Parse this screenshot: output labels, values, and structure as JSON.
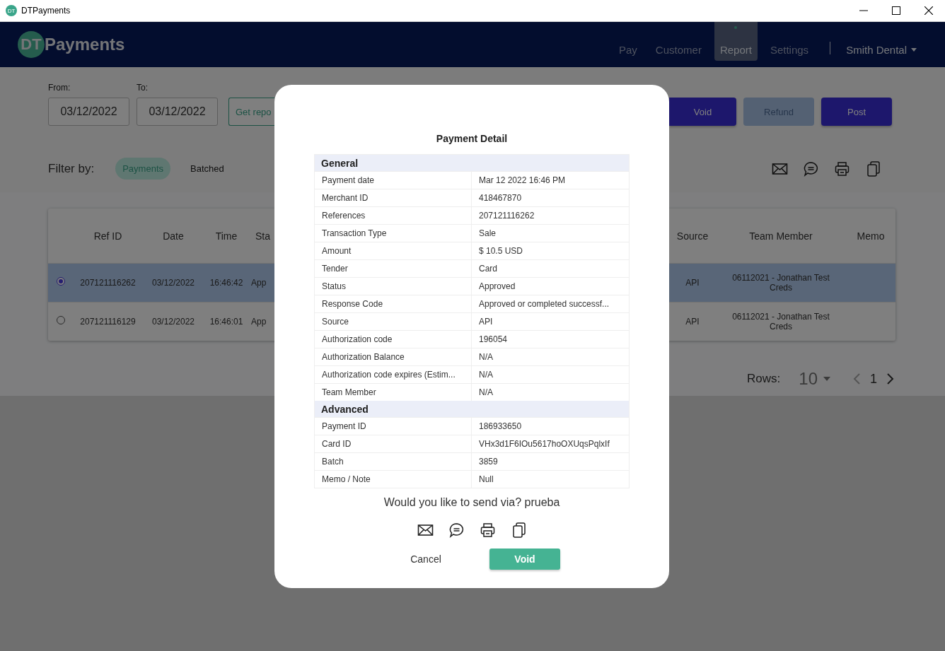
{
  "window": {
    "title": "DTPayments",
    "app_icon": "DT"
  },
  "header": {
    "logo_mark": "DT",
    "logo_text": "Payments",
    "nav": [
      {
        "label": "Pay",
        "selected": false
      },
      {
        "label": "Customer",
        "selected": false
      },
      {
        "label": "Report",
        "selected": true
      },
      {
        "label": "Settings",
        "selected": false
      }
    ],
    "account": "Smith Dental"
  },
  "filters": {
    "from_label": "From:",
    "from_value": "03/12/2022",
    "to_label": "To:",
    "to_value": "03/12/2022",
    "get_report": "Get repo",
    "actions": [
      {
        "label": "Void",
        "disabled": false
      },
      {
        "label": "Refund",
        "disabled": true
      },
      {
        "label": "Post",
        "disabled": false
      }
    ],
    "filter_label": "Filter by:",
    "chips": [
      {
        "label": "Payments",
        "selected": true
      },
      {
        "label": "Batched",
        "selected": false
      }
    ]
  },
  "table": {
    "columns": [
      "Ref ID",
      "Date",
      "Time",
      "Sta",
      "Source",
      "Team Member",
      "Memo"
    ],
    "rows": [
      {
        "selected": true,
        "cells": [
          "207121116262",
          "03/12/2022",
          "16:46:42",
          "App",
          "API",
          "06112021 - Jonathan Test Creds"
        ]
      },
      {
        "selected": false,
        "cells": [
          "207121116129",
          "03/12/2022",
          "16:46:01",
          "App",
          "API",
          "06112021 - Jonathan Test Creds"
        ]
      }
    ]
  },
  "pagination": {
    "rows_label": "Rows:",
    "rows_value": "10",
    "page": "1"
  },
  "dialog": {
    "title": "Payment Detail",
    "sections": [
      {
        "heading": "General",
        "rows": [
          {
            "label": "Payment date",
            "value": "Mar 12 2022 16:46 PM"
          },
          {
            "label": "Merchant ID",
            "value": "418467870"
          },
          {
            "label": "References",
            "value": "207121116262"
          },
          {
            "label": "Transaction Type",
            "value": "Sale"
          },
          {
            "label": "Amount",
            "value": "$ 10.5 USD"
          },
          {
            "label": "Tender",
            "value": "Card"
          },
          {
            "label": "Status",
            "value": "Approved"
          },
          {
            "label": "Response Code",
            "value": "Approved or completed successf..."
          },
          {
            "label": "Source",
            "value": "API"
          },
          {
            "label": "Authorization code",
            "value": "196054"
          },
          {
            "label": "Authorization Balance",
            "value": "N/A"
          },
          {
            "label": "Authorization code expires (Estim...",
            "value": "N/A"
          },
          {
            "label": "Team Member",
            "value": "N/A"
          }
        ]
      },
      {
        "heading": "Advanced",
        "rows": [
          {
            "label": "Payment ID",
            "value": "186933650"
          },
          {
            "label": "Card ID",
            "value": "VHx3d1F6IOu5617hoOXUqsPqlxIf"
          },
          {
            "label": "Batch",
            "value": "3859"
          },
          {
            "label": "Memo / Note",
            "value": "Null"
          }
        ]
      }
    ],
    "prompt": "Would you like to send via? prueba",
    "cancel": "Cancel",
    "confirm": "Void"
  }
}
